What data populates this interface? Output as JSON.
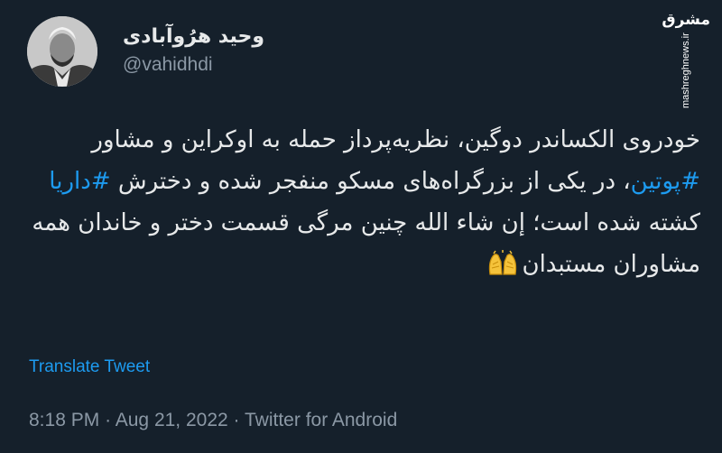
{
  "author": {
    "display_name": "وحید هرُوآبادی",
    "handle": "@vahidhdi"
  },
  "watermark": {
    "logo_text": "مشرق",
    "site": "mashreghnews.ir"
  },
  "tweet": {
    "text_parts": [
      "خودروی الکساندر دوگین، نظریه‌پرداز حمله به اوکراین و مشاور ",
      "#پوتین",
      "، در یکی از بزرگراه‌های مسکو منفجر شده و دخترش ",
      "#داریا",
      " کشته شده است؛ إن شاء الله چنین مرگی قسمت دختر و خاندان همه مشاوران مستبدان"
    ],
    "emoji": "folded-hands-emoji"
  },
  "translate_label": "Translate Tweet",
  "meta": {
    "time": "8:18 PM",
    "separator": "·",
    "date": "Aug 21, 2022",
    "source": "Twitter for Android"
  },
  "colors": {
    "background": "#15202b",
    "text": "#e7e9ea",
    "secondary": "#8b98a5",
    "link": "#1d9bf0"
  }
}
